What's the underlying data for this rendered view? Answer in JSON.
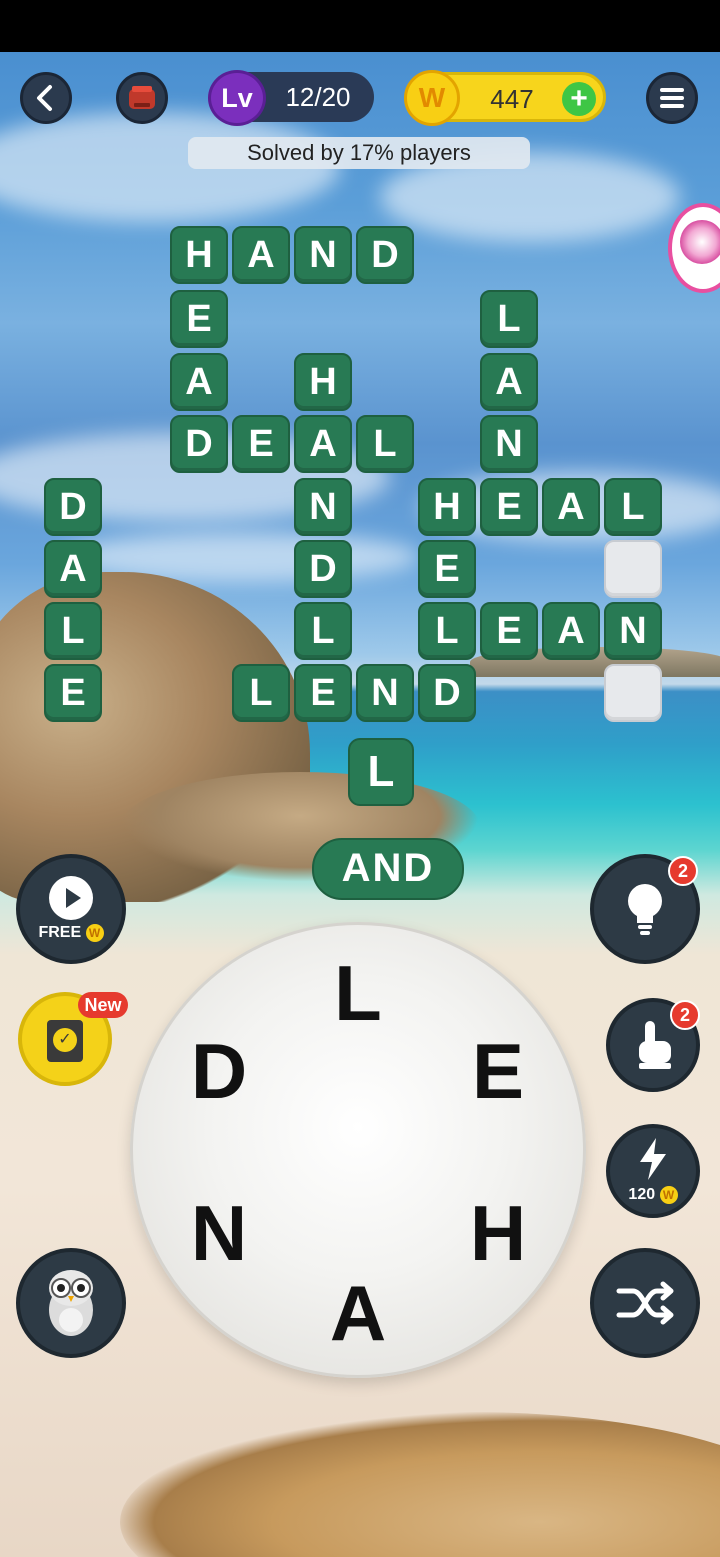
{
  "top_bar": {
    "level_prefix": "Lv",
    "level_progress": "12/20",
    "coin_symbol": "W",
    "coins": "447",
    "solved_text": "Solved by 17% players"
  },
  "board": {
    "rows": [
      {
        "tiles": [
          "H",
          "A",
          "N",
          "D"
        ]
      },
      {
        "tiles": [
          "E",
          "L"
        ]
      },
      {
        "tiles": [
          "A",
          "H",
          "A"
        ]
      },
      {
        "tiles": [
          "D",
          "E",
          "A",
          "L",
          "N"
        ]
      },
      {
        "tiles": [
          "D",
          "N",
          "H",
          "E",
          "A",
          "L"
        ]
      },
      {
        "tiles": [
          "A",
          "D",
          "E",
          ""
        ]
      },
      {
        "tiles": [
          "L",
          "L",
          "L",
          "E",
          "A",
          "N"
        ]
      },
      {
        "tiles": [
          "E",
          "L",
          "E",
          "N",
          "D",
          ""
        ]
      }
    ],
    "extra_l": "L",
    "current_word": "AND"
  },
  "wheel": {
    "letters": [
      "L",
      "E",
      "H",
      "A",
      "N",
      "D"
    ]
  },
  "buttons": {
    "free_label": "FREE",
    "coin_mark": "W",
    "new_label": "New",
    "hint_badge": "2",
    "finger_badge": "2",
    "bolt_cost": "120"
  },
  "colors": {
    "tile": "#287a54",
    "accent_purple": "#7b2fbd",
    "coin_yellow": "#f7d51c"
  },
  "icons": [
    "back-icon",
    "piggy-bank-icon",
    "menu-icon",
    "flower-icon",
    "play-icon",
    "news-book-icon",
    "lightbulb-icon",
    "finger-tap-icon",
    "lightning-icon",
    "owl-icon",
    "shuffle-icon"
  ]
}
